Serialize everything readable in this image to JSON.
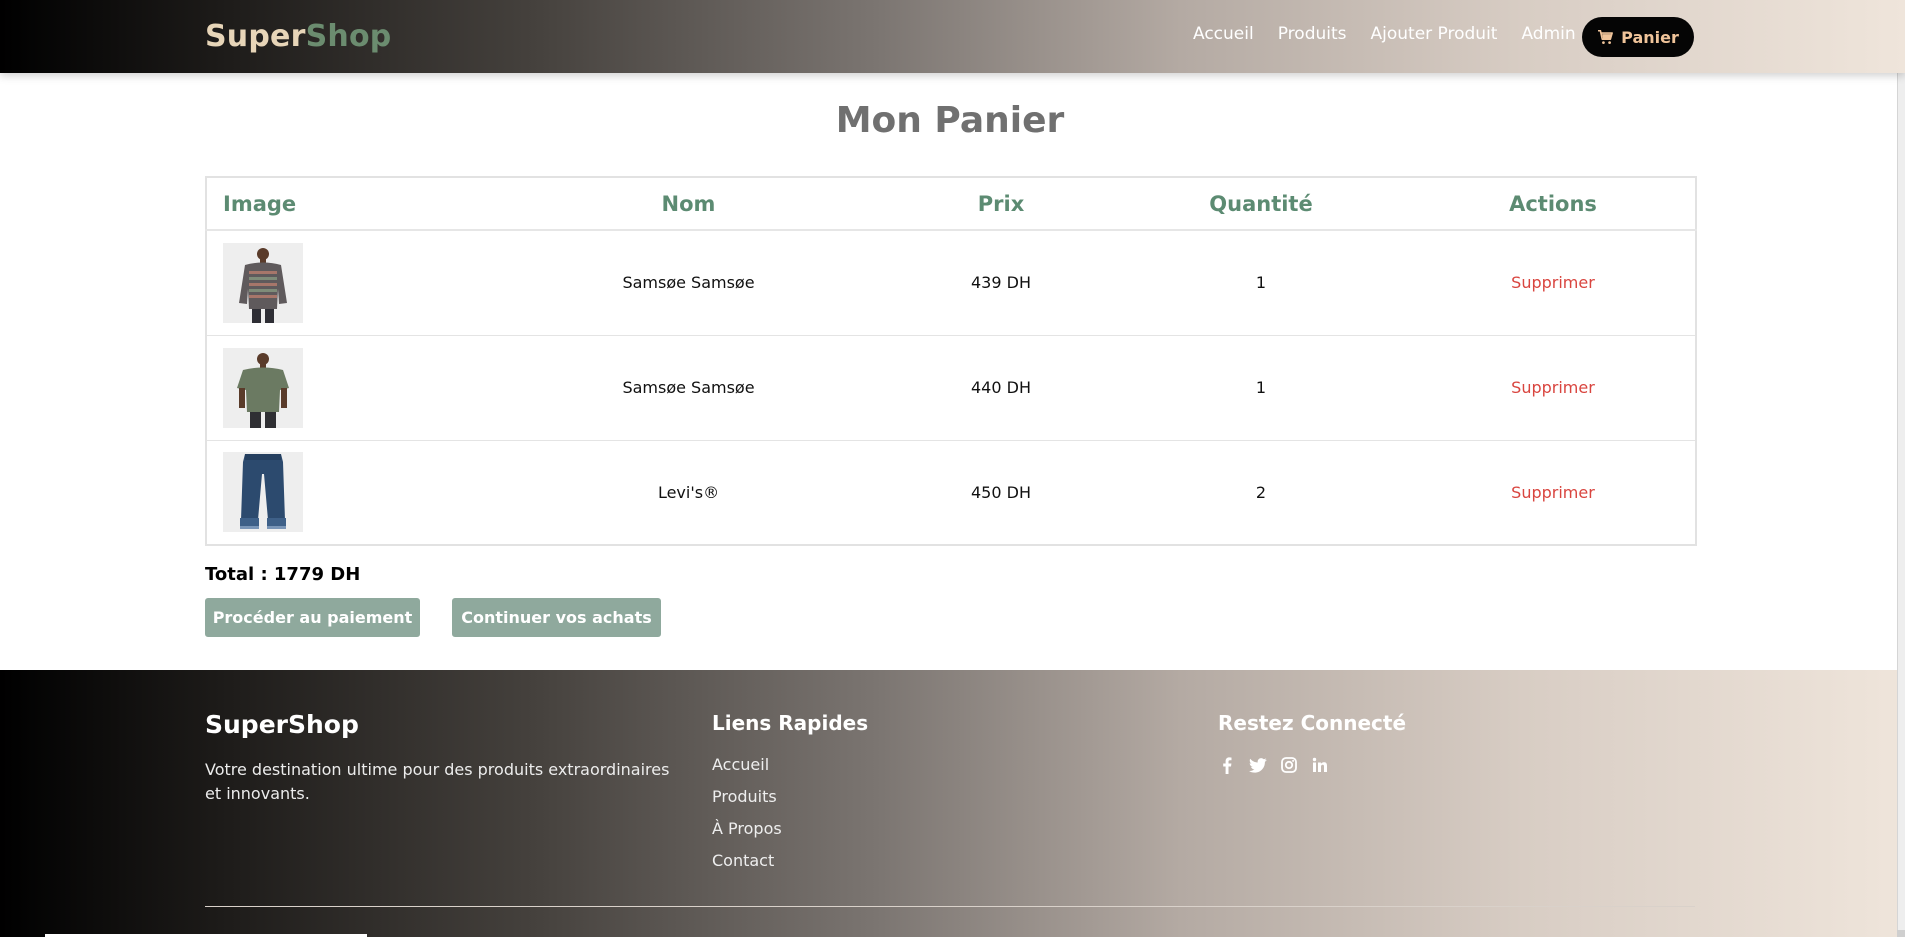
{
  "colors": {
    "accent_green": "#5c8b72",
    "button_bg": "#8fa99d",
    "delete_red": "#d9453f",
    "cart_text": "#f0c49a"
  },
  "nav": {
    "brand_part1": "Super",
    "brand_part2": "Shop",
    "links": [
      "Accueil",
      "Produits",
      "Ajouter Produit",
      "Admin"
    ],
    "cart_label": "Panier",
    "cart_icon": "shopping-cart-icon"
  },
  "main": {
    "title": "Mon Panier",
    "table": {
      "headers": [
        "Image",
        "Nom",
        "Prix",
        "Quantité",
        "Actions"
      ],
      "rows": [
        {
          "image": "knit-sweater",
          "name": "Samsøe Samsøe",
          "price": "439 DH",
          "quantity": "1",
          "action": "Supprimer"
        },
        {
          "image": "green-tshirt",
          "name": "Samsøe Samsøe",
          "price": "440 DH",
          "quantity": "1",
          "action": "Supprimer"
        },
        {
          "image": "blue-jeans",
          "name": "Levi's®",
          "price": "450 DH",
          "quantity": "2",
          "action": "Supprimer"
        }
      ]
    },
    "total": "Total : 1779 DH",
    "checkout_label": "Procéder au paiement",
    "continue_label": "Continuer vos achats"
  },
  "footer": {
    "brand": "SuperShop",
    "description": "Votre destination ultime pour des produits extraordinaires et innovants.",
    "quick_links_title": "Liens Rapides",
    "quick_links": [
      "Accueil",
      "Produits",
      "À Propos",
      "Contact"
    ],
    "connect_title": "Restez Connecté",
    "socials": [
      "facebook-icon",
      "twitter-icon",
      "instagram-icon",
      "linkedin-icon"
    ]
  }
}
